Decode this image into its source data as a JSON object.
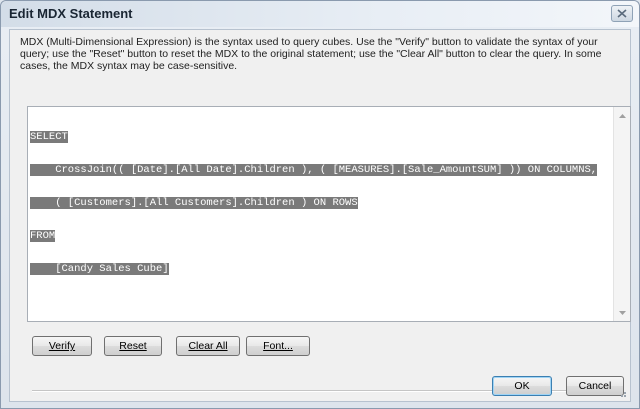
{
  "window": {
    "title": "Edit MDX Statement"
  },
  "description": "MDX (Multi-Dimensional Expression) is the syntax used to query cubes.  Use the \"Verify\" button to validate the syntax of your query; use the \"Reset\" button to reset the MDX to the original statement; use the \"Clear All\" button to clear the query.  In some cases, the MDX syntax may be case-sensitive.",
  "editor": {
    "lines": [
      "SELECT",
      "    CrossJoin(( [Date].[All Date].Children ), ( [MEASURES].[Sale_AmountSUM] )) ON COLUMNS,",
      "    ( [Customers].[All Customers].Children ) ON ROWS",
      "FROM",
      "    [Candy Sales Cube]"
    ]
  },
  "buttons": {
    "verify": "Verify",
    "reset": "Reset",
    "clear_all": "Clear All",
    "font": "Font...",
    "ok": "OK",
    "cancel": "Cancel"
  },
  "icons": {
    "close": "close-icon",
    "scroll_up": "scroll-up-arrow-icon",
    "scroll_down": "scroll-down-arrow-icon",
    "resize_grip": "resize-grip-icon"
  }
}
